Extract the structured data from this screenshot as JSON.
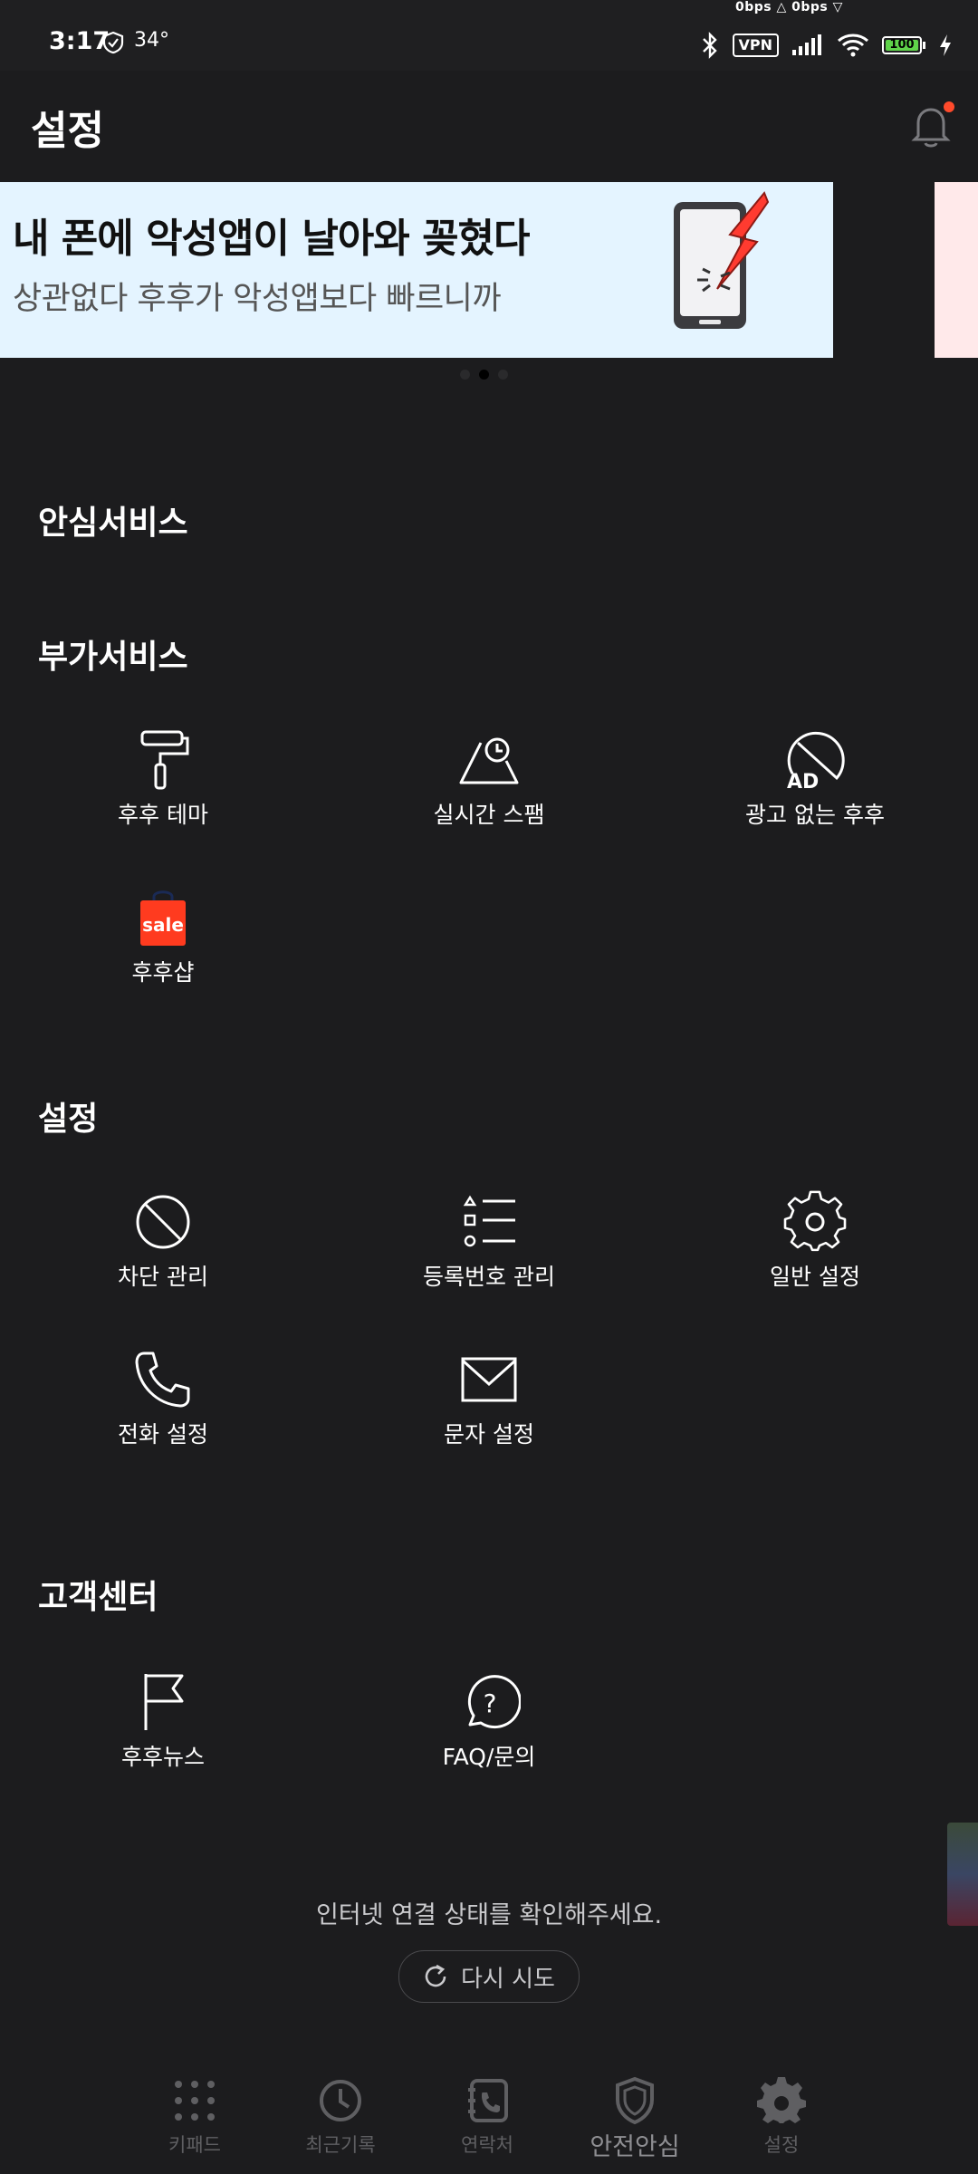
{
  "status_bar": {
    "time": "3:17",
    "temperature": "34°",
    "network_speed": "0bps △  0bps ▽",
    "vpn_label": "VPN",
    "battery": "100"
  },
  "app_bar": {
    "title": "설정"
  },
  "banner": {
    "title": "내 폰에 악성앱이 날아와 꽂혔다",
    "subtitle": "상관없다 후후가 악성앱보다 빠르니까",
    "page_count": 3,
    "active_page": 2
  },
  "sections": {
    "safe_service": {
      "title": "안심서비스"
    },
    "extra_service": {
      "title": "부가서비스",
      "items": [
        {
          "label": "후후 테마",
          "icon": "paint-roller-icon"
        },
        {
          "label": "실시간 스팸",
          "icon": "realtime-spam-icon"
        },
        {
          "label": "광고 없는 후후",
          "icon": "no-ad-icon"
        },
        {
          "label": "후후샵",
          "icon": "sale-bag-icon",
          "badge": "sale"
        }
      ]
    },
    "settings": {
      "title": "설정",
      "items": [
        {
          "label": "차단 관리",
          "icon": "block-icon"
        },
        {
          "label": "등록번호 관리",
          "icon": "list-icon"
        },
        {
          "label": "일반 설정",
          "icon": "gear-icon"
        },
        {
          "label": "전화 설정",
          "icon": "phone-icon"
        },
        {
          "label": "문자 설정",
          "icon": "mail-icon"
        }
      ]
    },
    "support": {
      "title": "고객센터",
      "items": [
        {
          "label": "후후뉴스",
          "icon": "flag-icon"
        },
        {
          "label": "FAQ/문의",
          "icon": "question-bubble-icon"
        }
      ]
    }
  },
  "network": {
    "message": "인터넷 연결 상태를 확인해주세요.",
    "retry_label": "다시 시도"
  },
  "bottom_nav": {
    "items": [
      {
        "label": "키패드",
        "icon": "keypad-icon"
      },
      {
        "label": "최근기록",
        "icon": "clock-icon"
      },
      {
        "label": "연락처",
        "icon": "contacts-icon"
      },
      {
        "label": "안전안심",
        "icon": "shield-icon"
      },
      {
        "label": "설정",
        "icon": "gear-icon"
      }
    ]
  },
  "colors": {
    "background": "#1c1c1e",
    "accent": "#ff4a2b",
    "banner_bg": "#e4f4ff",
    "sale_red": "#ff3b1f"
  }
}
